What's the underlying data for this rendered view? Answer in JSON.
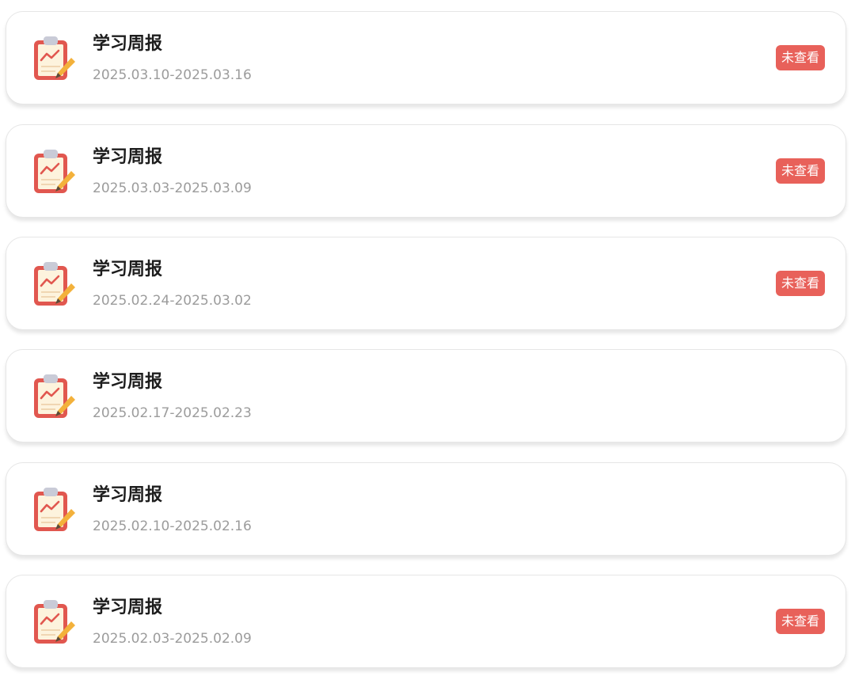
{
  "colors": {
    "badge_background": "#e8615a",
    "badge_text": "#ffffff",
    "title_text": "#1d1d1d",
    "date_text": "#9c9c9c",
    "card_border": "#e6e6e6"
  },
  "reports": [
    {
      "icon": "clipboard-chart-icon",
      "title": "学习周报",
      "date_range": "2025.03.10-2025.03.16",
      "status": "未查看"
    },
    {
      "icon": "clipboard-chart-icon",
      "title": "学习周报",
      "date_range": "2025.03.03-2025.03.09",
      "status": "未查看"
    },
    {
      "icon": "clipboard-chart-icon",
      "title": "学习周报",
      "date_range": "2025.02.24-2025.03.02",
      "status": "未查看"
    },
    {
      "icon": "clipboard-chart-icon",
      "title": "学习周报",
      "date_range": "2025.02.17-2025.02.23",
      "status": ""
    },
    {
      "icon": "clipboard-chart-icon",
      "title": "学习周报",
      "date_range": "2025.02.10-2025.02.16",
      "status": ""
    },
    {
      "icon": "clipboard-chart-icon",
      "title": "学习周报",
      "date_range": "2025.02.03-2025.02.09",
      "status": "未查看"
    }
  ]
}
